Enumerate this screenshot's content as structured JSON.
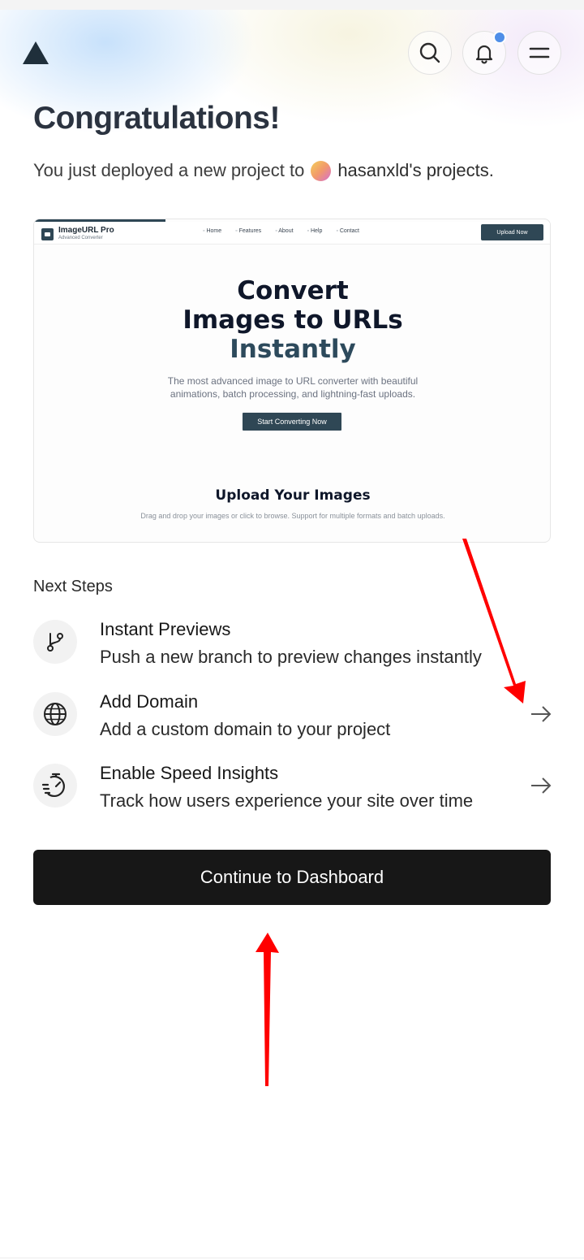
{
  "header": {
    "logo_icon": "triangle-logo-icon",
    "search_icon": "search-icon",
    "bell_icon": "bell-icon",
    "menu_icon": "hamburger-menu-icon",
    "notification_dot_color": "#4f8ee8"
  },
  "main": {
    "title": "Congratulations!",
    "subtitle_prefix": "You just deployed a new project to",
    "owner": "hasanxld's projects."
  },
  "preview": {
    "brand": "ImageURL Pro",
    "brand_sub": "Advanced Converter",
    "nav": [
      "Home",
      "Features",
      "About",
      "Help",
      "Contact"
    ],
    "upload_button": "Upload Now",
    "headline_line1": "Convert",
    "headline_line2": "Images to URLs",
    "headline_line3": "Instantly",
    "description": "The most advanced image to URL converter with beautiful animations, batch processing, and lightning-fast uploads.",
    "cta": "Start Converting Now",
    "section_title": "Upload Your Images",
    "section_sub": "Drag and drop your images or click to browse. Support for multiple formats and batch uploads."
  },
  "next_steps": {
    "label": "Next Steps",
    "items": [
      {
        "icon": "git-branch-icon",
        "title": "Instant Previews",
        "desc": "Push a new branch to preview changes instantly"
      },
      {
        "icon": "globe-icon",
        "title": "Add Domain",
        "desc": "Add a custom domain to your project"
      },
      {
        "icon": "speedometer-icon",
        "title": "Enable Speed Insights",
        "desc": "Track how users experience your site over time"
      }
    ]
  },
  "continue_button": "Continue to Dashboard",
  "colors": {
    "primary_button": "#171717",
    "preview_accent": "#2f4755",
    "annotation_arrow": "#ff0000"
  }
}
